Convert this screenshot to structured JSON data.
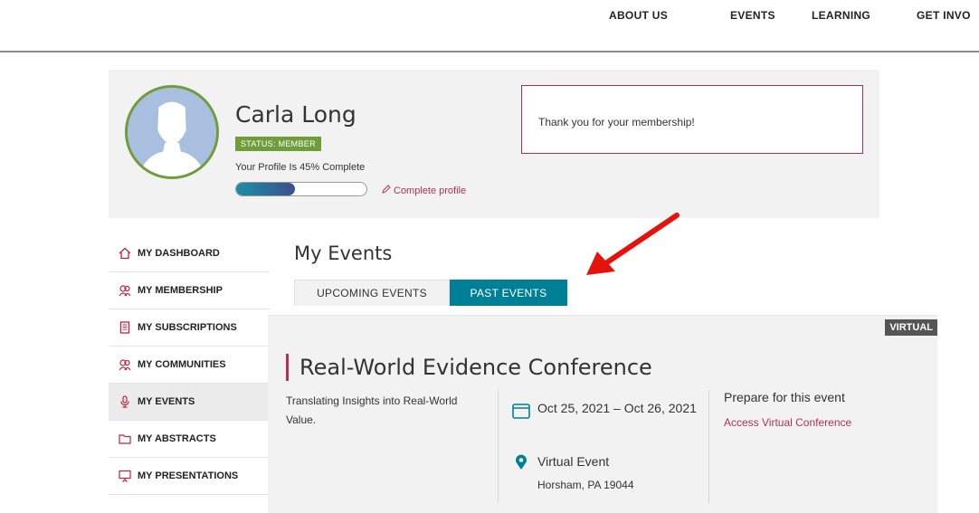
{
  "topnav": {
    "items": [
      "ABOUT US",
      "EVENTS",
      "LEARNING",
      "GET INVO"
    ]
  },
  "profile": {
    "name": "Carla Long",
    "status": "STATUS: MEMBER",
    "completion_text": "Your Profile Is 45% Complete",
    "completion_value": 0.45,
    "complete_link": "Complete profile",
    "message": "Thank you for your membership!"
  },
  "sidebar": {
    "items": [
      {
        "label": "MY DASHBOARD",
        "icon": "home-icon"
      },
      {
        "label": "MY MEMBERSHIP",
        "icon": "members-icon"
      },
      {
        "label": "MY SUBSCRIPTIONS",
        "icon": "document-icon"
      },
      {
        "label": "MY COMMUNITIES",
        "icon": "members-icon"
      },
      {
        "label": "MY EVENTS",
        "icon": "microphone-icon"
      },
      {
        "label": "MY ABSTRACTS",
        "icon": "folder-icon"
      },
      {
        "label": "MY PRESENTATIONS",
        "icon": "presentation-icon"
      }
    ],
    "active": "MY EVENTS"
  },
  "main": {
    "title": "My Events",
    "tabs": {
      "upcoming": "UPCOMING EVENTS",
      "past": "PAST EVENTS"
    },
    "event": {
      "badge": "VIRTUAL",
      "title": "Real-World Evidence Conference",
      "description": "Translating Insights into Real-World Value.",
      "dates": "Oct 25, 2021 – Oct 26, 2021",
      "location_name": "Virtual Event",
      "location_address": "Horsham, PA 19044",
      "prepare_heading": "Prepare for this event",
      "access_link": "Access Virtual Conference"
    }
  },
  "colors": {
    "accent_teal": "#008096",
    "accent_red": "#b0315a",
    "status_green": "#6e9d3a",
    "icon_red": "#c2233a",
    "annotation_red": "#e8120c"
  }
}
